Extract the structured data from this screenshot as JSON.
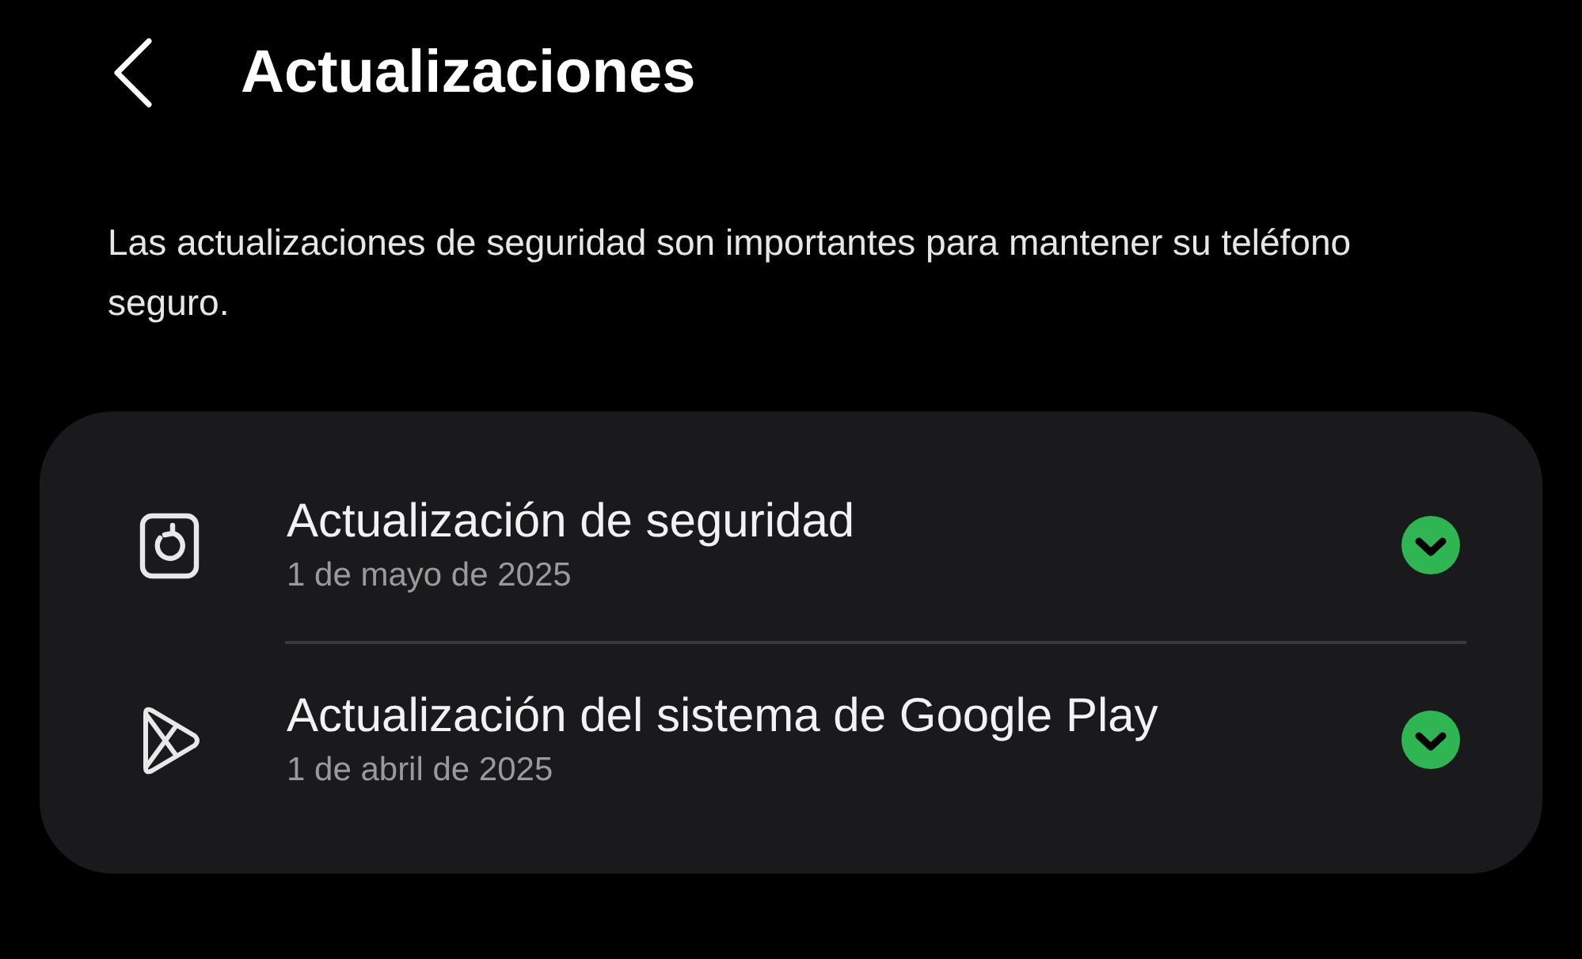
{
  "header": {
    "title": "Actualizaciones"
  },
  "description": "Las actualizaciones de seguridad son importantes para mantener su teléfono seguro.",
  "updates": [
    {
      "kind": "security",
      "title": "Actualización de seguridad",
      "date": "1 de mayo de 2025",
      "completed": true
    },
    {
      "kind": "play",
      "title": "Actualización del sistema de Google Play",
      "date": "1 de abril de 2025",
      "completed": true
    }
  ]
}
